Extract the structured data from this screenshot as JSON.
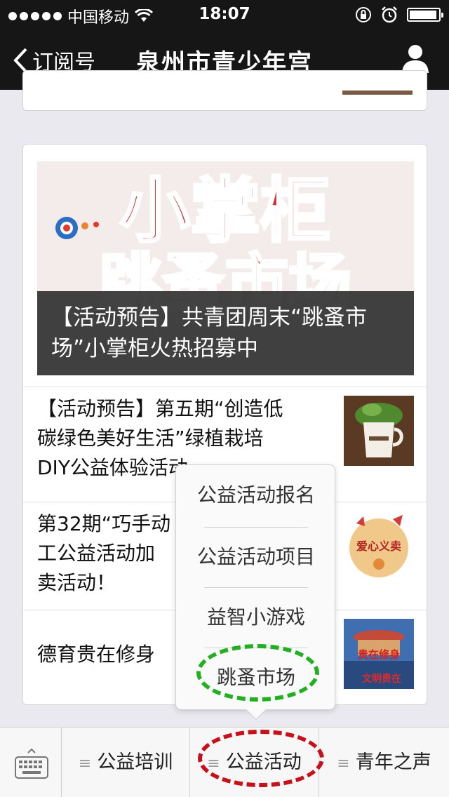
{
  "status": {
    "carrier": "中国移动",
    "time": "18:07",
    "battery_level": 0.95
  },
  "nav": {
    "back_label": "订阅号",
    "title": "泉州市青少年宫"
  },
  "article_main": {
    "caption": "【活动预告】共青团周末“跳蚤市场”小掌柜火热招募中",
    "banner_text": "小掌柜跳蚤市场"
  },
  "articles": [
    {
      "lines": [
        "【活动预告】第五期“创造低",
        "碳绿色美好生活”绿植栽培",
        "DIY公益体验活动"
      ]
    },
    {
      "lines": [
        "第32期“巧手动",
        "工公益活动加",
        "卖活动！"
      ],
      "thumb_text": "爱心义卖"
    },
    {
      "lines": [
        "德育贵在修身"
      ],
      "thumb_text": [
        "贵在修身",
        "文明贵在"
      ]
    }
  ],
  "popup_menu": {
    "items": [
      "公益活动报名",
      "公益活动项目",
      "益智小游戏",
      "跳蚤市场"
    ]
  },
  "bottom_menu": {
    "tabs": [
      "公益培训",
      "公益活动",
      "青年之声"
    ],
    "menu_glyph": "≡"
  },
  "colors": {
    "topbar": "#161616",
    "highlight_green": "#22b022",
    "highlight_red": "#c8101a"
  }
}
